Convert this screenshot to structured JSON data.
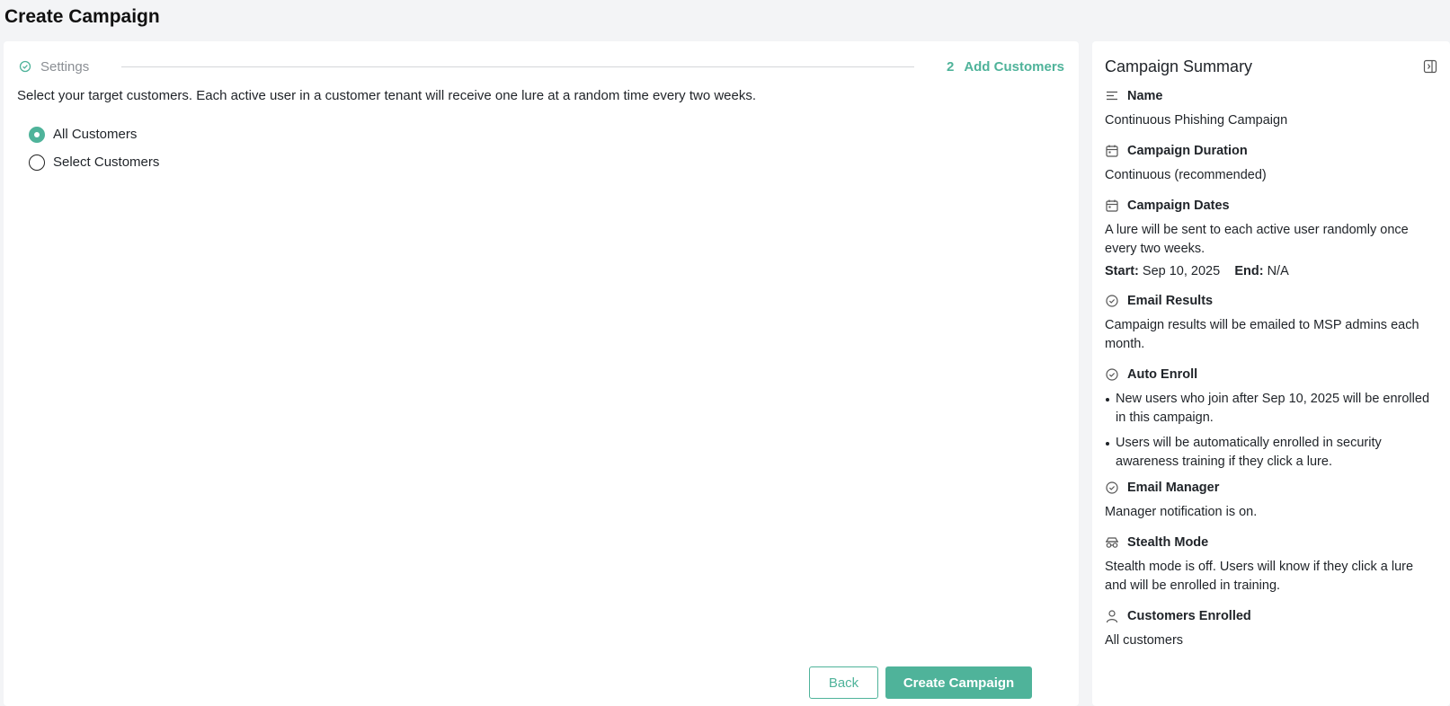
{
  "page": {
    "title": "Create Campaign"
  },
  "stepper": {
    "step1_label": "Settings",
    "step2_number": "2",
    "step2_label": "Add Customers"
  },
  "main": {
    "intro": "Select your target customers. Each active user in a customer tenant will receive one lure at a random time every two weeks.",
    "options": [
      {
        "label": "All Customers",
        "selected": true
      },
      {
        "label": "Select Customers",
        "selected": false
      }
    ],
    "back_label": "Back",
    "create_label": "Create Campaign"
  },
  "summary": {
    "title": "Campaign Summary",
    "name": {
      "heading": "Name",
      "value": "Continuous Phishing Campaign"
    },
    "duration": {
      "heading": "Campaign Duration",
      "value": "Continuous (recommended)"
    },
    "dates": {
      "heading": "Campaign Dates",
      "value": "A lure will be sent to each active user randomly once every two weeks.",
      "start_label": "Start:",
      "start_value": "Sep 10, 2025",
      "end_label": "End:",
      "end_value": "N/A"
    },
    "email_results": {
      "heading": "Email Results",
      "value": "Campaign results will be emailed to MSP admins each month."
    },
    "auto_enroll": {
      "heading": "Auto Enroll",
      "bullets": [
        "New users who join after Sep 10, 2025 will be enrolled in this campaign.",
        "Users will be automatically enrolled in security awareness training if they click a lure."
      ]
    },
    "email_manager": {
      "heading": "Email Manager",
      "value": "Manager notification is on."
    },
    "stealth": {
      "heading": "Stealth Mode",
      "value": "Stealth mode is off. Users will know if they click a lure and will be enrolled in training."
    },
    "customers": {
      "heading": "Customers Enrolled",
      "value": "All customers"
    }
  },
  "colors": {
    "accent": "#4fb39a",
    "background": "#f3f4f6",
    "text": "#1f2328"
  },
  "icons": {
    "step_done": "check-circle-icon",
    "collapse": "sidebar-collapse-icon",
    "name": "text-lines-icon",
    "calendar": "calendar-icon",
    "check": "check-circle-icon",
    "stealth": "incognito-icon",
    "user": "user-icon"
  }
}
